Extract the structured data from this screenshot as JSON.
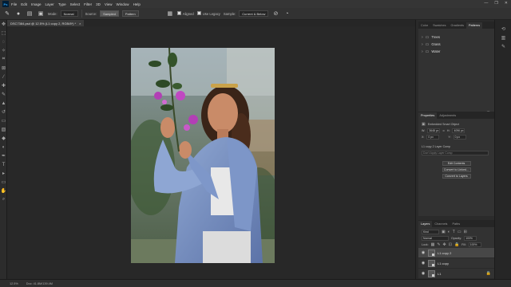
{
  "menu": {
    "logo": "Ps",
    "items": [
      "File",
      "Edit",
      "Image",
      "Layer",
      "Type",
      "Select",
      "Filter",
      "3D",
      "View",
      "Window",
      "Help"
    ]
  },
  "options": {
    "mode_label": "Mode:",
    "mode_value": "Normal",
    "source_label": "Source:",
    "sampled_label": "Sampled",
    "pattern_label": "Pattern",
    "aligned_label": "Aligned",
    "legacy_label": "Use Legacy",
    "sample_label": "Sample:",
    "sample_value": "Current & Below"
  },
  "document": {
    "tab_title": "DSC7384.psd @ 12.5% (L1 copy 2, RGB/8*) *",
    "close": "×"
  },
  "panels": {
    "top_tabs": [
      "Color",
      "Swatches",
      "Gradients",
      "Patterns"
    ],
    "active_top_tab": "Patterns",
    "pattern_folders": [
      "Trees",
      "Grass",
      "Water"
    ],
    "properties_tabs": [
      "Properties",
      "Adjustments"
    ],
    "smart_object_label": "Embedded Smart Object",
    "w_label": "W:",
    "w_value": "3648 px",
    "h_label": "H:",
    "h_value": "4096 px",
    "x_label": "X:",
    "x_value": "0 px",
    "y_label": "Y:",
    "y_value": "0 px",
    "comps_label": "L1 copy 2 Layer Comp",
    "comps_placeholder": "Don't Apply Layer Comp",
    "btn_edit": "Edit Contents",
    "btn_linked": "Convert to Linked...",
    "btn_layers": "Convert to Layers",
    "layers_tabs": [
      "Layers",
      "Channels",
      "Paths"
    ],
    "kind_label": "Kind",
    "blend_mode": "Normal",
    "opacity_label": "Opacity:",
    "opacity_value": "100%",
    "lock_label": "Lock:",
    "fill_label": "Fill:",
    "fill_value": "100%",
    "layers": [
      {
        "name": "L1 copy 2",
        "selected": true
      },
      {
        "name": "L1 copy",
        "selected": false
      },
      {
        "name": "L1",
        "selected": false
      }
    ]
  },
  "status": {
    "zoom": "12.5%",
    "doc_info": "Doc: 41.8M/139.4M"
  }
}
